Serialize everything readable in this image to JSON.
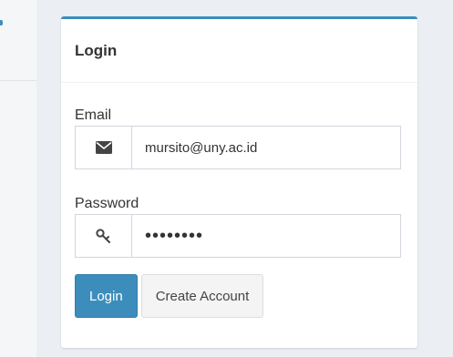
{
  "colors": {
    "accent": "#3c8dbc",
    "background": "#ebeef2",
    "card": "#ffffff"
  },
  "login_box": {
    "title": "Login",
    "email": {
      "label": "Email",
      "value": "mursito@uny.ac.id",
      "icon": "envelope-icon"
    },
    "password": {
      "label": "Password",
      "value": "mursito1",
      "icon": "key-icon"
    },
    "buttons": {
      "login_label": "Login",
      "create_account_label": "Create Account"
    }
  }
}
